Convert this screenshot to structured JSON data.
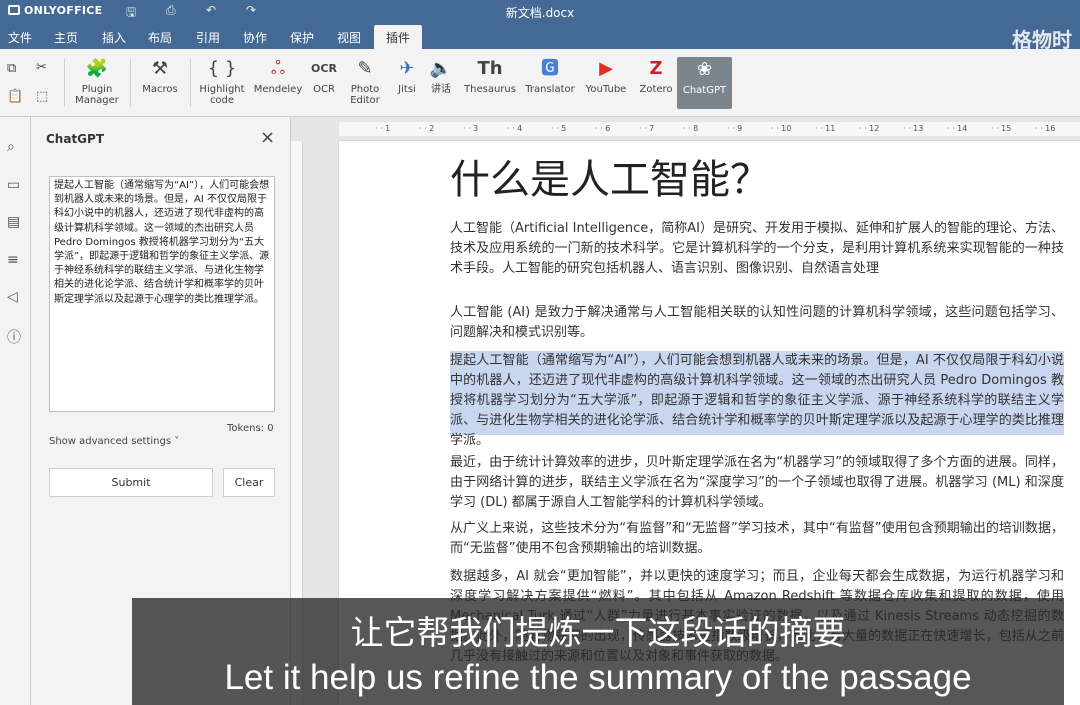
{
  "app": {
    "brand": "ONLYOFFICE",
    "document_title": "新文档.docx",
    "watermark": "格物时"
  },
  "menu": [
    "文件",
    "主页",
    "插入",
    "布局",
    "引用",
    "协作",
    "保护",
    "视图",
    "插件"
  ],
  "active_menu": "插件",
  "toolbar": {
    "plugin_manager": "Plugin\nManager",
    "macros": "Macros",
    "highlight_code": "Highlight\ncode",
    "mendeley": "Mendeley",
    "ocr": "OCR",
    "photo_editor": "Photo\nEditor",
    "jitsi": "Jitsi",
    "speech": "讲话",
    "thesaurus": "Thesaurus",
    "translator": "Translator",
    "youtube": "YouTube",
    "zotero": "Zotero",
    "chatgpt": "ChatGPT"
  },
  "panel": {
    "title": "ChatGPT",
    "prompt_text": "提起人工智能（通常缩写为“AI”），人们可能会想到机器人或未来的场景。但是，AI 不仅仅局限于科幻小说中的机器人，还迈进了现代非虚构的高级计算机科学领域。这一领域的杰出研究人员 Pedro Domingos 教授将机器学习划分为“五大学派”，即起源于逻辑和哲学的象征主义学派、源于神经系统科学的联结主义学派、与进化生物学相关的进化论学派、结合统计学和概率学的贝叶斯定理学派以及起源于心理学的类比推理学派。",
    "tokens": "Tokens: 0",
    "advanced": "Show advanced settings ˅",
    "submit": "Submit",
    "clear": "Clear"
  },
  "document": {
    "heading": "什么是人工智能？",
    "paragraphs": [
      "人工智能（Artificial Intelligence，简称AI）是研究、开发用于模拟、延伸和扩展人的智能的理论、方法、技术及应用系统的一门新的技术科学。它是计算机科学的一个分支，是利用计算机系统来实现智能的一种技术手段。人工智能的研究包括机器人、语言识别、图像识别、自然语言处理",
      "人工智能 (AI) 是致力于解决通常与人工智能相关联的认知性问题的计算机科学领域，这些问题包括学习、问题解决和模式识别等。",
      "提起人工智能（通常缩写为“AI”），人们可能会想到机器人或未来的场景。但是，AI 不仅仅局限于科幻小说中的机器人，还迈进了现代非虚构的高级计算机科学领域。这一领域的杰出研究人员 Pedro Domingos 教授将机器学习划分为“五大学派”，即起源于逻辑和哲学的象征主义学派、源于神经系统科学的联结主义学派、与进化生物学相关的进化论学派、结合统计学和概率学的贝叶斯定理学派以及起源于心理学的类比推理学派。",
      "最近，由于统计计算效率的进步，贝叶斯定理学派在名为“机器学习”的领域取得了多个方面的进展。同样，由于网络计算的进步，联结主义学派在名为“深度学习”的一个子领域也取得了进展。机器学习 (ML) 和深度学习 (DL) 都属于源自人工智能学科的计算机科学领域。",
      "从广义上来说，这些技术分为“有监督”和“无监督”学习技术，其中“有监督”使用包含预期输出的培训数据，而“无监督”使用不包含预期输出的培训数据。",
      "数据越多，AI 就会“更加智能”，并以更快的速度学习；而且，企业每天都会生成数据，为运行机器学习和深度学习解决方案提供“燃料”。其中包括从 Amazon Redshift 等数据仓库收集和提取的数据，使用 Mechanical Turk 通过“人群”力量进行基本事实验证的数据，以及通过 Kinesis Streams 动态挖掘的数据。此外，随着物联网的出现，传感器技术呈指数级增长，因此，有大量的数据正在快速增长，包括从之前几乎没有接触过的来源和位置以及对象和事件获取的数据。"
    ]
  },
  "subtitles": {
    "cn": "让它帮我们提炼一下这段话的摘要",
    "en": "Let it help us refine the summary of the passage"
  },
  "colors": {
    "header": "#446995",
    "selection": "#c9d6ef",
    "chatgpt_active": "#7d858c"
  }
}
